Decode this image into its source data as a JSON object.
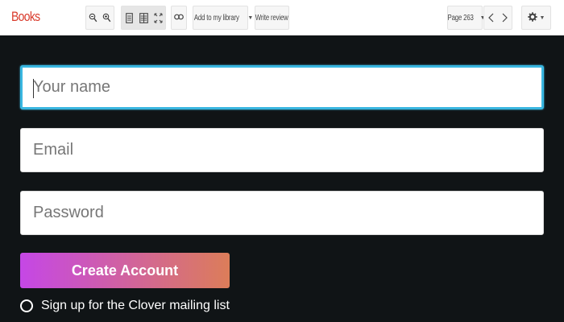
{
  "toolbar": {
    "brand": "Books",
    "add_library_label": "Add to my library",
    "write_review_label": "Write review",
    "page_label": "Page 263",
    "icons": [
      "zoom-out-icon",
      "zoom-in-icon",
      "single-page-icon",
      "two-page-icon",
      "fullscreen-icon",
      "link-icon",
      "chevron-left-icon",
      "chevron-right-icon",
      "gear-icon"
    ]
  },
  "form": {
    "name_placeholder": "Your name",
    "email_placeholder": "Email",
    "password_placeholder": "Password",
    "submit_label": "Create Account",
    "mailing_label": "Sign up for the Clover mailing list",
    "mailing_checked": false
  },
  "colors": {
    "background": "#101416",
    "brand": "#d93a2b",
    "focus": "#39b6e0",
    "gradient_start": "#c547e6",
    "gradient_end": "#dc7d59"
  }
}
